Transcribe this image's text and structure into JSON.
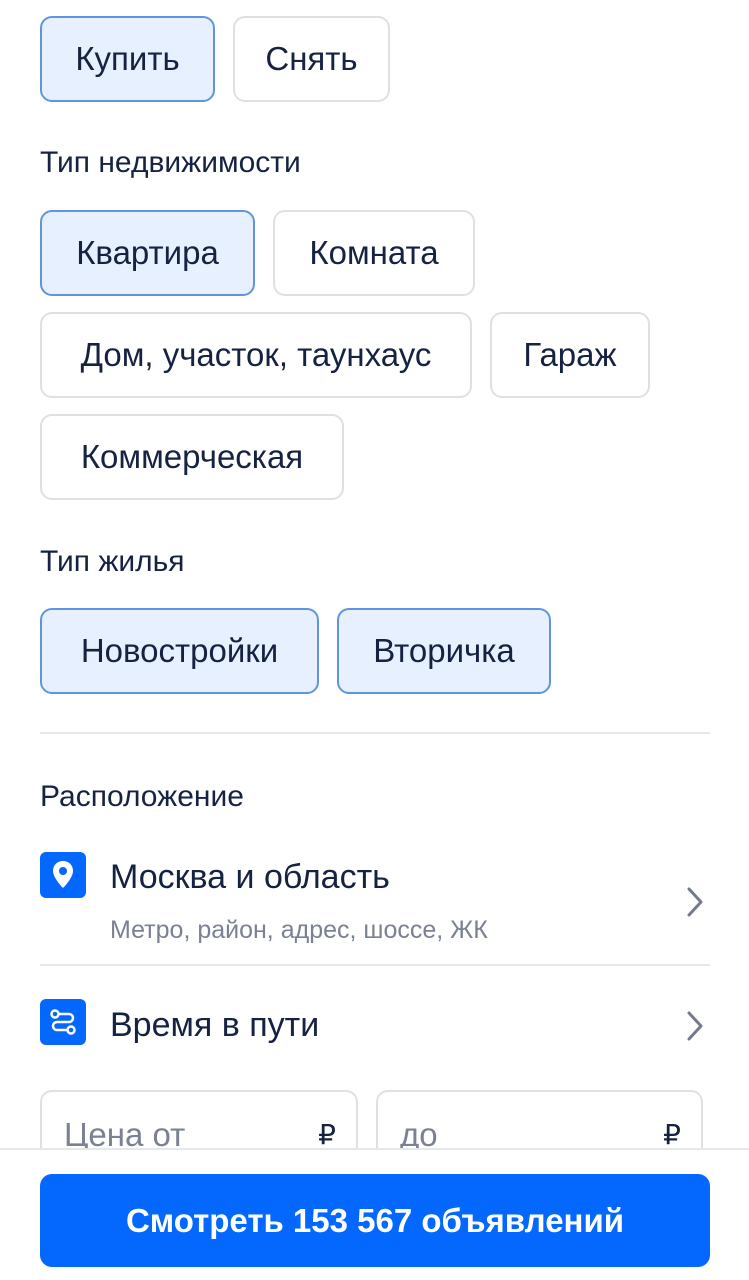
{
  "deal": {
    "buy_label": "Купить",
    "rent_label": "Снять"
  },
  "property_type": {
    "label": "Тип недвижимости",
    "options": [
      "Квартира",
      "Комната",
      "Дом, участок, таунхаус",
      "Гараж",
      "Коммерческая"
    ]
  },
  "housing_type": {
    "label": "Тип жилья",
    "options": [
      "Новостройки",
      "Вторичка"
    ]
  },
  "location": {
    "section_label": "Расположение",
    "title": "Москва и область",
    "subtitle": "Метро, район, адрес, шоссе, ЖК",
    "icon": "location-pin-icon"
  },
  "travel_time": {
    "title": "Время в пути",
    "icon": "route-icon"
  },
  "price": {
    "from_placeholder": "Цена от",
    "to_placeholder": "до",
    "currency": "₽"
  },
  "cta": {
    "label": "Смотреть 153 567 объявлений"
  },
  "colors": {
    "accent": "#0468ff",
    "selected_bg": "#e6f0ff",
    "selected_border": "#5f94df",
    "text": "#152242",
    "muted": "#7a8194"
  }
}
